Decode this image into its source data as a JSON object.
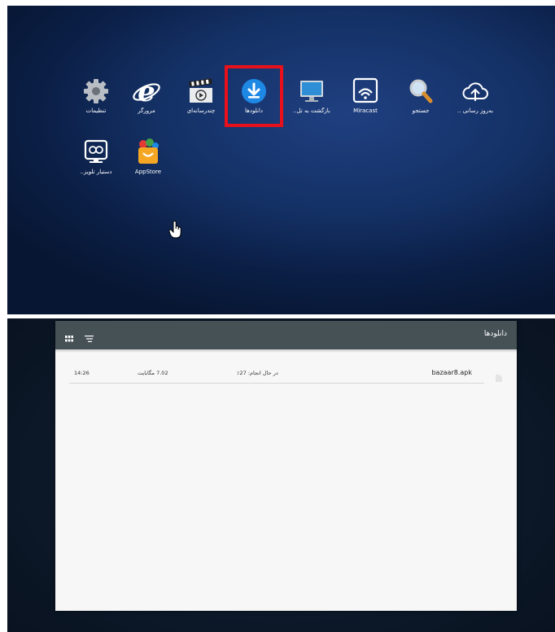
{
  "launcher": {
    "apps": [
      {
        "id": "settings",
        "label": "تنظیمات",
        "icon": "gear-icon"
      },
      {
        "id": "browser",
        "label": "مرورگر",
        "icon": "internet-explorer-icon"
      },
      {
        "id": "multimedia",
        "label": "چند‌رسانه‌ای",
        "icon": "clapperboard-icon"
      },
      {
        "id": "downloads",
        "label": "دانلودها",
        "icon": "download-icon",
        "highlighted": true
      },
      {
        "id": "back-to-tv",
        "label": "بازگشت به تل..",
        "icon": "monitor-icon"
      },
      {
        "id": "miracast",
        "label": "Miracast",
        "icon": "screen-cast-icon"
      },
      {
        "id": "search",
        "label": "جستجو",
        "icon": "magnifier-icon"
      },
      {
        "id": "update",
        "label": "به‌روز رسانی ..",
        "icon": "cloud-upload-icon"
      },
      {
        "id": "tv-assistant",
        "label": "دستیار تلویز..",
        "icon": "tv-assistant-icon"
      },
      {
        "id": "appstore",
        "label": "AppStore",
        "icon": "app-store-bag-icon"
      }
    ],
    "highlight_color": "#e8101a"
  },
  "downloads": {
    "title": "دانلودها",
    "items": [
      {
        "name": "bazaar8.apk",
        "status": "در حال انجام: 27٪",
        "size": "7.02 مگابایت",
        "time": "14:26"
      }
    ]
  },
  "colors": {
    "toolbar": "#465156",
    "launcher_bg": "#143166",
    "download_blue": "#1e88e5"
  }
}
